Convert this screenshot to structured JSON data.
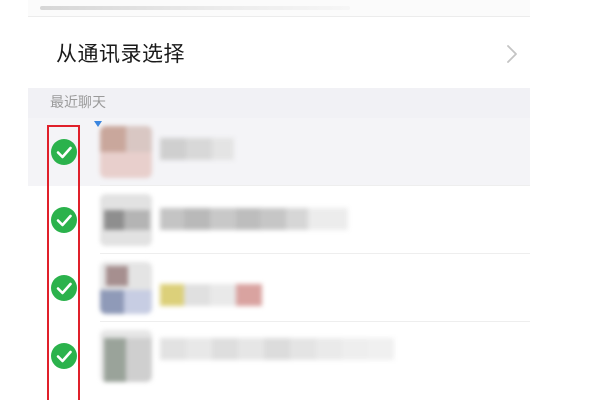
{
  "contacts_entry": {
    "label": "从通讯录选择",
    "chevron_icon": "chevron-right-icon"
  },
  "recent_section": {
    "label": "最近聊天"
  },
  "chats": [
    {
      "selected": true,
      "name": "",
      "unread_icon": "unread-dot-icon"
    },
    {
      "selected": true,
      "name": ""
    },
    {
      "selected": true,
      "name": ""
    },
    {
      "selected": true,
      "name": ""
    }
  ],
  "colors": {
    "check_green": "#2bb24c",
    "highlight_red": "#e0202a",
    "section_bg": "#f1f1f5",
    "text_primary": "#1a1a1a",
    "text_secondary": "#9a9a9a"
  }
}
